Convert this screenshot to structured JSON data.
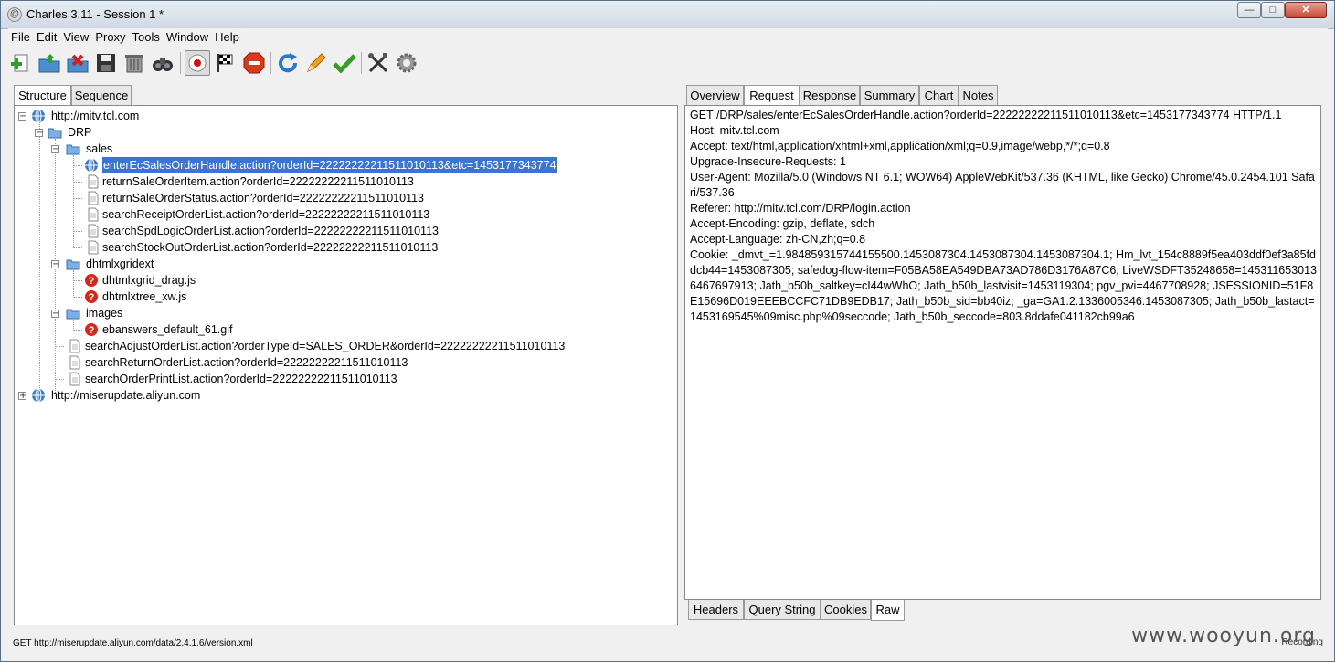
{
  "window": {
    "title": "Charles 3.11 - Session 1 *",
    "app_icon": "charles-icon"
  },
  "menu": [
    "File",
    "Edit",
    "View",
    "Proxy",
    "Tools",
    "Window",
    "Help"
  ],
  "toolbar": {
    "icons": [
      "new-session-icon",
      "open-session-icon",
      "close-session-icon",
      "save-session-icon",
      "clear-session-icon",
      "find-icon",
      "record-icon",
      "throttle-flag-icon",
      "stop-icon",
      "refresh-icon",
      "edit-icon",
      "validate-icon",
      "tools-icon",
      "settings-icon"
    ]
  },
  "left_tabs": [
    "Structure",
    "Sequence"
  ],
  "tree": [
    {
      "label": "http://mitv.tcl.com",
      "type": "host",
      "expanded": true
    },
    {
      "label": "DRP",
      "type": "folder",
      "expanded": true
    },
    {
      "label": "sales",
      "type": "folder",
      "expanded": true
    },
    {
      "label": "enterEcSalesOrderHandle.action?orderId=22222222211511010113&etc=1453177343774",
      "type": "active",
      "selected": true
    },
    {
      "label": "returnSaleOrderItem.action?orderId=22222222211511010113",
      "type": "file"
    },
    {
      "label": "returnSaleOrderStatus.action?orderId=22222222211511010113",
      "type": "file"
    },
    {
      "label": "searchReceiptOrderList.action?orderId=22222222211511010113",
      "type": "file"
    },
    {
      "label": "searchSpdLogicOrderList.action?orderId=22222222211511010113",
      "type": "file"
    },
    {
      "label": "searchStockOutOrderList.action?orderId=22222222211511010113",
      "type": "file"
    },
    {
      "label": "dhtmlxgridext",
      "type": "folder",
      "expanded": true
    },
    {
      "label": "dhtmlxgrid_drag.js",
      "type": "error"
    },
    {
      "label": "dhtmlxtree_xw.js",
      "type": "error"
    },
    {
      "label": "images",
      "type": "folder",
      "expanded": true
    },
    {
      "label": "ebanswers_default_61.gif",
      "type": "error"
    },
    {
      "label": "searchAdjustOrderList.action?orderTypeId=SALES_ORDER&orderId=22222222211511010113",
      "type": "file"
    },
    {
      "label": "searchReturnOrderList.action?orderId=22222222211511010113",
      "type": "file"
    },
    {
      "label": "searchOrderPrintList.action?orderId=22222222211511010113",
      "type": "file"
    },
    {
      "label": "http://miserupdate.aliyun.com",
      "type": "host",
      "expanded": false
    }
  ],
  "right_tabs": [
    "Overview",
    "Request",
    "Response",
    "Summary",
    "Chart",
    "Notes"
  ],
  "right_active_tab": "Request",
  "request_lines": [
    "GET /DRP/sales/enterEcSalesOrderHandle.action?orderId=22222222211511010113&etc=1453177343774 HTTP/1.1",
    "Host: mitv.tcl.com",
    "Accept: text/html,application/xhtml+xml,application/xml;q=0.9,image/webp,*/*;q=0.8",
    "Upgrade-Insecure-Requests: 1",
    "User-Agent: Mozilla/5.0 (Windows NT 6.1; WOW64) AppleWebKit/537.36 (KHTML, like Gecko) Chrome/45.0.2454.101 Safari/537.36",
    "Referer: http://mitv.tcl.com/DRP/login.action",
    "Accept-Encoding: gzip, deflate, sdch",
    "Accept-Language: zh-CN,zh;q=0.8",
    "Cookie: _dmvt_=1.984859315744155500.1453087304.1453087304.1453087304.1; Hm_lvt_154c8889f5ea403ddf0ef3a85fddcb44=1453087305; safedog-flow-item=F05BA58EA549DBA73AD786D3176A87C6; LiveWSDFT35248658=1453116530136467697913; Jath_b50b_saltkey=cI44wWhO; Jath_b50b_lastvisit=1453119304; pgv_pvi=4467708928; JSESSIONID=51F8E15696D019EEEBCCFC71DB9EDB17; Jath_b50b_sid=bb40iz; _ga=GA1.2.1336005346.1453087305; Jath_b50b_lastact=1453169545%09misc.php%09seccode; Jath_b50b_seccode=803.8ddafe041182cb99a6"
  ],
  "bottom_tabs": [
    "Headers",
    "Query String",
    "Cookies",
    "Raw"
  ],
  "bottom_active_tab": "Raw",
  "status_text": "GET http://miserupdate.aliyun.com/data/2.4.1.6/version.xml",
  "recording_text": "Recording",
  "watermark": "www.wooyun.org",
  "colors": {
    "selection": "#3875d7",
    "error": "#d9261c",
    "folder": "#5b9bd5"
  }
}
